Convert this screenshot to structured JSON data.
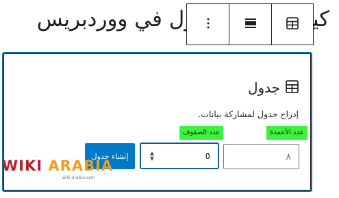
{
  "heading": {
    "text": "كيفية إضافة جدول في ووردبريس"
  },
  "toolbar": {
    "more_options_icon": "vertical-ellipsis-icon",
    "align_icon": "align-center-icon",
    "block_type_icon": "table-icon"
  },
  "table_block": {
    "title": "جدول",
    "title_icon": "table-icon",
    "instructions": "إدراج جدول لمشاركة بيانات.",
    "columns": {
      "label": "عدد الأعمدة",
      "value": "٨"
    },
    "rows": {
      "label": "عدد الصفوف",
      "value": "٥"
    },
    "create_button_label": "إنشاء جدول"
  },
  "watermark": {
    "part1": "WIKI",
    "part2": "ARABIA",
    "tagline": "wiki-arabia.com"
  },
  "colors": {
    "accent_blue": "#0079c7",
    "focus_border": "#0a6fa8",
    "label_highlight": "#3cf23c",
    "watermark_red": "#b91c2a",
    "watermark_orange": "#e8a023"
  }
}
